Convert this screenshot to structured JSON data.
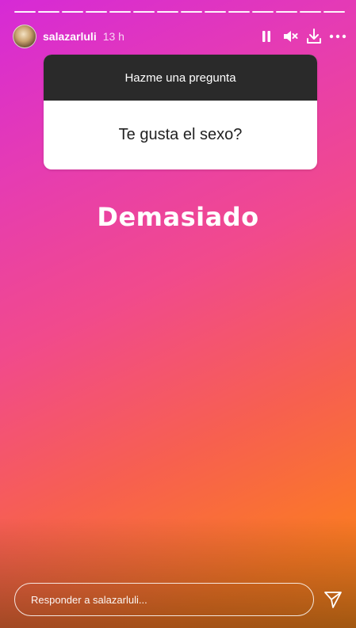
{
  "story": {
    "segment_count": 14,
    "colors": {
      "gradient_start": "#d62ad6",
      "gradient_end": "#f8861a",
      "question_header_bg": "#2a2a2a",
      "question_body_bg": "#ffffff"
    }
  },
  "header": {
    "username": "salazarluli",
    "time": "13 h",
    "icons": [
      "pause-icon",
      "mute-icon",
      "download-icon",
      "more-icon"
    ]
  },
  "question_sticker": {
    "title": "Hazme una pregunta",
    "question": "Te gusta el sexo?"
  },
  "answer_text": "Demasiado",
  "footer": {
    "reply_placeholder": "Responder a salazarluli...",
    "send_icon": "send-icon"
  }
}
